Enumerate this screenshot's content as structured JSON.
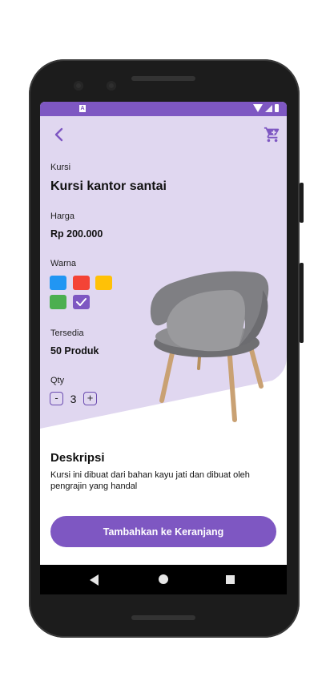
{
  "status_bar": {
    "notification_glyph": "A"
  },
  "header": {
    "back_icon": "chevron-left-icon",
    "cart_icon": "cart-icon"
  },
  "product": {
    "category_label": "Kursi",
    "name": "Kursi kantor santai",
    "price_label": "Harga",
    "price": "Rp 200.000",
    "color_label": "Warna",
    "colors": [
      "#2196f3",
      "#f44336",
      "#ffc107",
      "#4caf50",
      "#7e57c2"
    ],
    "selected_color_index": 4,
    "stock_label": "Tersedia",
    "stock": "50 Produk",
    "qty_label": "Qty",
    "qty_minus": "-",
    "qty_value": "3",
    "qty_plus": "+"
  },
  "description": {
    "title": "Deskripsi",
    "text": "Kursi ini dibuat dari bahan kayu jati dan dibuat oleh pengrajin yang handal"
  },
  "cta": {
    "label": "Tambahkan ke Keranjang"
  },
  "theme": {
    "accent": "#7e57c2",
    "top_background": "#e0d7f0"
  }
}
